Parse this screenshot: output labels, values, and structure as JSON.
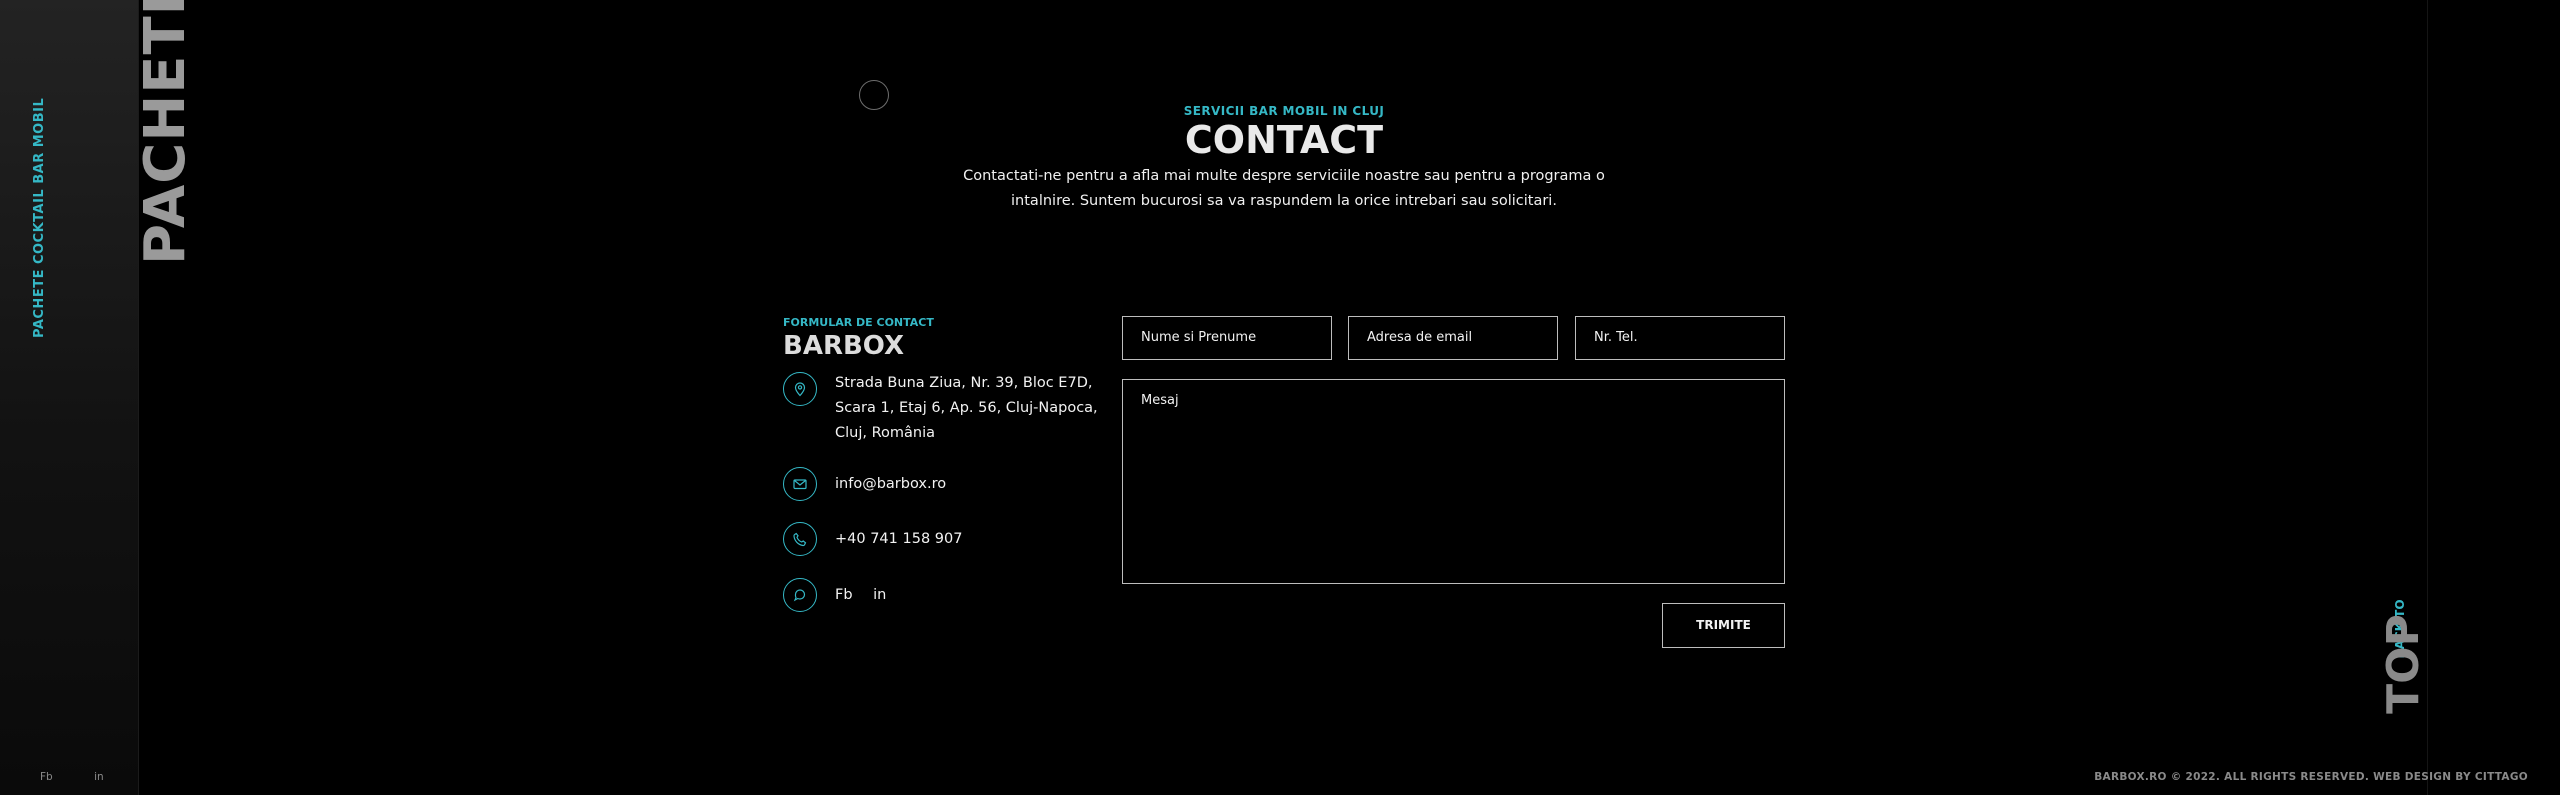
{
  "side": {
    "subtitle": "PACHETE COCKTAIL BAR MOBIL",
    "title": "PACHETE"
  },
  "back_to_top": {
    "subtitle": "BACK TO",
    "title": "TOP"
  },
  "hero": {
    "subtitle": "SERVICII BAR MOBIL IN CLUJ",
    "title": "CONTACT",
    "desc_line1": "Contactati-ne pentru a afla mai multe despre serviciile noastre sau pentru a programa o",
    "desc_line2": "intalnire. Suntem bucurosi sa va raspundem la orice intrebari sau solicitari."
  },
  "info": {
    "subtitle": "FORMULAR DE CONTACT",
    "title": "BARBOX",
    "address_line1": "Strada Buna Ziua, Nr. 39, Bloc E7D,",
    "address_line2": "Scara 1, Etaj 6, Ap. 56, Cluj-Napoca,",
    "address_line3": "Cluj, România",
    "email": "info@barbox.ro",
    "phone": "+40 741 158 907",
    "social_fb": "Fb",
    "social_in": "in"
  },
  "form": {
    "name_placeholder": "Nume si Prenume",
    "email_placeholder": "Adresa de email",
    "phone_placeholder": "Nr. Tel.",
    "message_placeholder": "Mesaj",
    "submit_label": "TRIMITE"
  },
  "footer": {
    "fb": "Fb",
    "in": "in",
    "copyright": "BARBOX.RO © 2022. ALL RIGHTS RESERVED. WEB DESIGN BY CITTAGO"
  },
  "colors": {
    "accent": "#35b8c6",
    "background": "#000000"
  },
  "icons": [
    "location-pin-icon",
    "envelope-icon",
    "phone-icon",
    "share-icon"
  ]
}
